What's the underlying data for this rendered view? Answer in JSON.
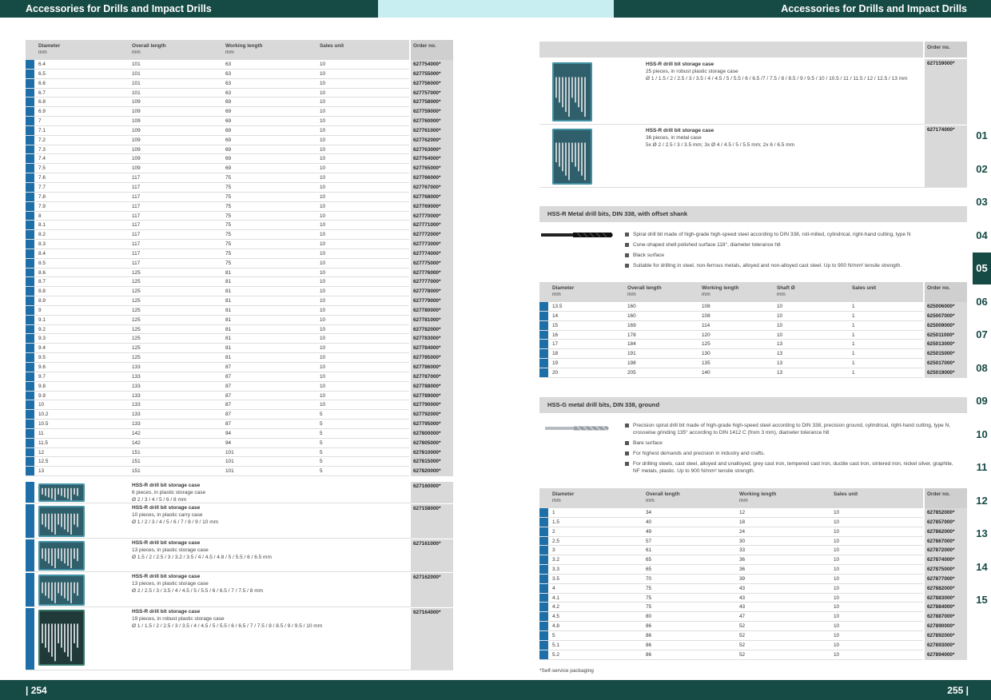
{
  "header": {
    "left_title": "Accessories for Drills and Impact Drills",
    "right_title": "Accessories for Drills and Impact Drills"
  },
  "footer": {
    "left_page": "| 254",
    "right_page": "255 |"
  },
  "colors": {
    "teal": "#164a45",
    "cyan": "#c9eef2",
    "blue_mark": "#1e6fa8",
    "grey_cell": "#d9d9d9"
  },
  "left_table": {
    "headers": {
      "diameter": "Diameter",
      "overall": "Overall length",
      "working": "Working length",
      "sales": "Sales unit",
      "order": "Order no.",
      "unit": "mm"
    },
    "rows": [
      [
        "6.4",
        "101",
        "63",
        "10",
        "627754000*"
      ],
      [
        "6.5",
        "101",
        "63",
        "10",
        "627755000*"
      ],
      [
        "6.6",
        "101",
        "63",
        "10",
        "627756000*"
      ],
      [
        "6.7",
        "101",
        "63",
        "10",
        "627757000*"
      ],
      [
        "6.8",
        "109",
        "69",
        "10",
        "627758000*"
      ],
      [
        "6.9",
        "109",
        "69",
        "10",
        "627759000*"
      ],
      [
        "7",
        "109",
        "69",
        "10",
        "627760000*"
      ],
      [
        "7.1",
        "109",
        "69",
        "10",
        "627761000*"
      ],
      [
        "7.2",
        "109",
        "69",
        "10",
        "627762000*"
      ],
      [
        "7.3",
        "109",
        "69",
        "10",
        "627763000*"
      ],
      [
        "7.4",
        "109",
        "69",
        "10",
        "627764000*"
      ],
      [
        "7.5",
        "109",
        "69",
        "10",
        "627765000*"
      ],
      [
        "7.6",
        "117",
        "75",
        "10",
        "627766000*"
      ],
      [
        "7.7",
        "117",
        "75",
        "10",
        "627767000*"
      ],
      [
        "7.8",
        "117",
        "75",
        "10",
        "627768000*"
      ],
      [
        "7.9",
        "117",
        "75",
        "10",
        "627769000*"
      ],
      [
        "8",
        "117",
        "75",
        "10",
        "627770000*"
      ],
      [
        "8.1",
        "117",
        "75",
        "10",
        "627771000*"
      ],
      [
        "8.2",
        "117",
        "75",
        "10",
        "627772000*"
      ],
      [
        "8.3",
        "117",
        "75",
        "10",
        "627773000*"
      ],
      [
        "8.4",
        "117",
        "75",
        "10",
        "627774000*"
      ],
      [
        "8.5",
        "117",
        "75",
        "10",
        "627775000*"
      ],
      [
        "8.6",
        "125",
        "81",
        "10",
        "627776000*"
      ],
      [
        "8.7",
        "125",
        "81",
        "10",
        "627777000*"
      ],
      [
        "8.8",
        "125",
        "81",
        "10",
        "627778000*"
      ],
      [
        "8.9",
        "125",
        "81",
        "10",
        "627779000*"
      ],
      [
        "9",
        "125",
        "81",
        "10",
        "627780000*"
      ],
      [
        "9.1",
        "125",
        "81",
        "10",
        "627781000*"
      ],
      [
        "9.2",
        "125",
        "81",
        "10",
        "627782000*"
      ],
      [
        "9.3",
        "125",
        "81",
        "10",
        "627783000*"
      ],
      [
        "9.4",
        "125",
        "81",
        "10",
        "627784000*"
      ],
      [
        "9.5",
        "125",
        "81",
        "10",
        "627785000*"
      ],
      [
        "9.6",
        "133",
        "87",
        "10",
        "627786000*"
      ],
      [
        "9.7",
        "133",
        "87",
        "10",
        "627787000*"
      ],
      [
        "9.8",
        "133",
        "87",
        "10",
        "627788000*"
      ],
      [
        "9.9",
        "133",
        "87",
        "10",
        "627789000*"
      ],
      [
        "10",
        "133",
        "87",
        "10",
        "627790000*"
      ],
      [
        "10.2",
        "133",
        "87",
        "5",
        "627792000*"
      ],
      [
        "10.5",
        "133",
        "87",
        "5",
        "627795000*"
      ],
      [
        "11",
        "142",
        "94",
        "5",
        "627800000*"
      ],
      [
        "11.5",
        "142",
        "94",
        "5",
        "627805000*"
      ],
      [
        "12",
        "151",
        "101",
        "5",
        "627810000*"
      ],
      [
        "12.5",
        "151",
        "101",
        "5",
        "627815000*"
      ],
      [
        "13",
        "151",
        "101",
        "5",
        "627820000*"
      ]
    ]
  },
  "left_sets": [
    {
      "name": "HSS-R drill bit storage case",
      "desc": "6 pieces, in plastic storage case",
      "sizes": "Ø 2 / 3 / 4 / 5 / 6 / 8 mm",
      "order": "627160000*"
    },
    {
      "name": "HSS-R drill bit storage case",
      "desc": "10 pieces, in plastic carry case",
      "sizes": "Ø 1 / 2 / 3 / 4 / 5 / 6 / 7 / 8 / 9 / 10 mm",
      "order": "627158000*"
    },
    {
      "name": "HSS-R drill bit storage case",
      "desc": "13 pieces, in plastic storage case",
      "sizes": "Ø 1.5 / 2 / 2.5 / 3 / 3.2 / 3.5 / 4 / 4.5 / 4.8 / 5 / 5.5 / 6 / 6.5 mm",
      "order": "627161000*"
    },
    {
      "name": "HSS-R drill bit storage case",
      "desc": "13 pieces, in plastic storage case",
      "sizes": "Ø 2 / 2.5 / 3 / 3.5 / 4 / 4.5 / 5 / 5.5 / 6 / 6.5 / 7 / 7.5 / 8 mm",
      "order": "627162000*"
    },
    {
      "name": "HSS-R drill bit storage case",
      "desc": "19 pieces, in robust plastic storage case",
      "sizes": "Ø 1 / 1.5 / 2 / 2.5 / 3 / 3.5 / 4 / 4.5 / 5 / 5.5 / 6 / 6.5 / 7 / 7.5 / 8 / 8.5 / 9 / 9.5 / 10 mm",
      "order": "627164000*"
    }
  ],
  "right_sets": {
    "order_header": "Order no.",
    "items": [
      {
        "name": "HSS-R drill bit storage case",
        "desc": "25 pieces, in robust plastic storage case",
        "sizes": "Ø 1 / 1.5 / 2 / 2.5 / 3 / 3.5 / 4 / 4.5 / 5 / 5.5 / 6 / 6.5 /7 / 7.5 / 8 / 8.5 / 9 / 9.5 / 10 / 10.5 / 11 / 11.5 / 12 / 12.5 / 13 mm",
        "order": "627159000*"
      },
      {
        "name": "HSS-R drill bit storage case",
        "desc": "36 pieces, in metal case",
        "sizes": "5x Ø 2 / 2.5 / 3 / 3.5 mm;  3x Ø 4 / 4.5 / 5 / 5.5 mm;  2x 6 / 6.5 mm",
        "order": "627174000*"
      }
    ]
  },
  "offset_shank": {
    "title": "HSS-R Metal drill bits, DIN 338, with offset shank",
    "bullets": [
      "Spiral drill bit made of high-grade high-speed steel according to DIN 338, roll-milled, cylindrical, right-hand cutting, type N",
      "Cone-shaped shell polished surface 118°, diameter tolerance h8",
      "Black surface",
      "Suitable for drilling in steel, non-ferrous metals, alloyed and non-alloyed cast steel. Up to 900 N/mm² tensile strength."
    ],
    "headers": {
      "diameter": "Diameter",
      "overall": "Overall length",
      "working": "Working length",
      "shaft": "Shaft Ø",
      "sales": "Sales unit",
      "order": "Order no.",
      "unit": "mm"
    },
    "rows": [
      [
        "13.5",
        "160",
        "108",
        "10",
        "1",
        "625006000*"
      ],
      [
        "14",
        "160",
        "108",
        "10",
        "1",
        "625007000*"
      ],
      [
        "15",
        "169",
        "114",
        "10",
        "1",
        "625009000*"
      ],
      [
        "16",
        "178",
        "120",
        "10",
        "1",
        "625011000*"
      ],
      [
        "17",
        "184",
        "125",
        "13",
        "1",
        "625013000*"
      ],
      [
        "18",
        "191",
        "130",
        "13",
        "1",
        "625015000*"
      ],
      [
        "19",
        "198",
        "135",
        "13",
        "1",
        "625017000*"
      ],
      [
        "20",
        "205",
        "140",
        "13",
        "1",
        "625019000*"
      ]
    ]
  },
  "ground": {
    "title": "HSS-G metal drill bits, DIN 338, ground",
    "bullets": [
      "Precision spiral drill bit made of high-grade high-speed steel according to DIN 338, precision ground, cylindrical, right-hand cutting, type N, crosswise grinding 135° according to DIN 1412 C (from 3 mm), diameter tolerance h8",
      "Bare surface",
      "For highest demands and precision in industry and crafts.",
      "For drilling steels, cast steel, alloyed and unalloyed, grey cast iron, tempered cast iron, ductile cast iron, sintered iron, nickel silver, graphite, NF metals, plastic. Up to 900 N/mm² tensile strength."
    ],
    "headers": {
      "diameter": "Diameter",
      "overall": "Overall length",
      "working": "Working length",
      "sales": "Sales unit",
      "order": "Order no.",
      "unit": "mm"
    },
    "rows": [
      [
        "1",
        "34",
        "12",
        "10",
        "627852000*"
      ],
      [
        "1.5",
        "40",
        "18",
        "10",
        "627857000*"
      ],
      [
        "2",
        "49",
        "24",
        "10",
        "627862000*"
      ],
      [
        "2.5",
        "57",
        "30",
        "10",
        "627867000*"
      ],
      [
        "3",
        "61",
        "33",
        "10",
        "627872000*"
      ],
      [
        "3.2",
        "65",
        "36",
        "10",
        "627874000*"
      ],
      [
        "3.3",
        "65",
        "36",
        "10",
        "627875000*"
      ],
      [
        "3.5",
        "70",
        "39",
        "10",
        "627877000*"
      ],
      [
        "4",
        "75",
        "43",
        "10",
        "627882000*"
      ],
      [
        "4.1",
        "75",
        "43",
        "10",
        "627883000*"
      ],
      [
        "4.2",
        "75",
        "43",
        "10",
        "627884000*"
      ],
      [
        "4.5",
        "80",
        "47",
        "10",
        "627887000*"
      ],
      [
        "4.8",
        "86",
        "52",
        "10",
        "627890000*"
      ],
      [
        "5",
        "86",
        "52",
        "10",
        "627892000*"
      ],
      [
        "5.1",
        "86",
        "52",
        "10",
        "627893000*"
      ],
      [
        "5.2",
        "86",
        "52",
        "10",
        "627894000*"
      ]
    ]
  },
  "footnote": "*Self-service packaging",
  "tabs": {
    "items": [
      "01",
      "02",
      "03",
      "04",
      "05",
      "06",
      "07",
      "08",
      "09",
      "10",
      "11",
      "12",
      "13",
      "14",
      "15"
    ],
    "active": "05"
  }
}
